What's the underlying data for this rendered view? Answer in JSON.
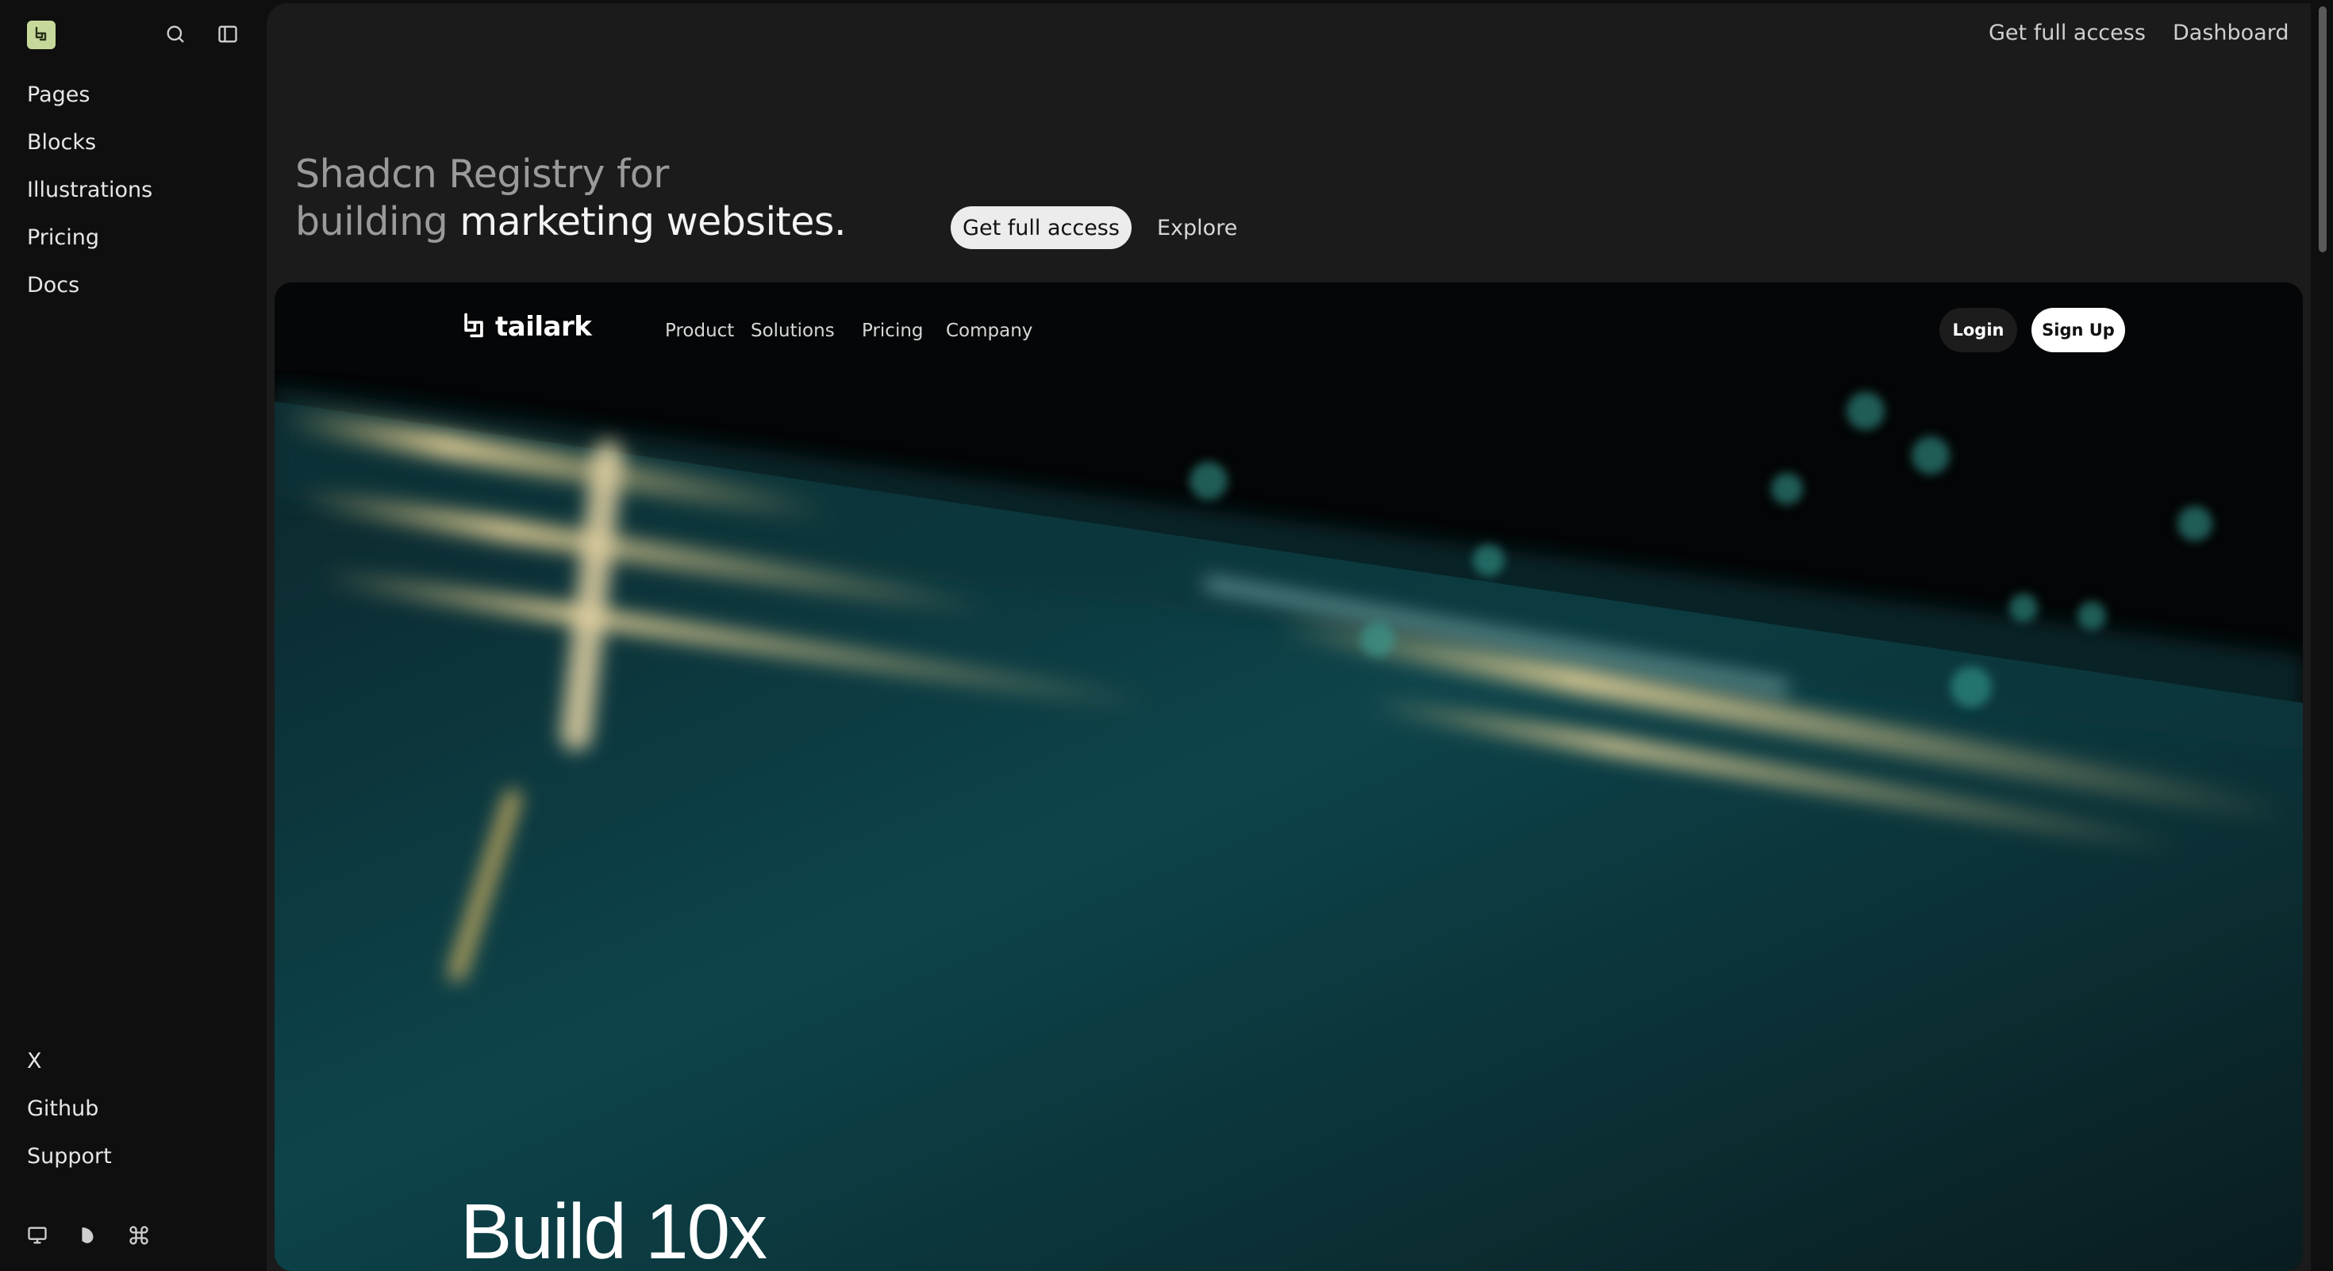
{
  "sidebar": {
    "items": [
      {
        "label": "Pages"
      },
      {
        "label": "Blocks"
      },
      {
        "label": "Illustrations"
      },
      {
        "label": "Pricing"
      },
      {
        "label": "Docs"
      }
    ],
    "footer_links": [
      {
        "label": "X"
      },
      {
        "label": "Github"
      },
      {
        "label": "Support"
      }
    ],
    "icons": [
      "logo-icon",
      "search-icon",
      "sidebar-toggle-icon",
      "monitor-icon",
      "theme-icon",
      "command-icon"
    ]
  },
  "topbar": {
    "get_full_access": "Get full access",
    "dashboard": "Dashboard"
  },
  "hero": {
    "line1": "Shadcn Registry for",
    "line2_muted": "building",
    "line2_strong": "marketing websites.",
    "primary_button": "Get full access",
    "secondary_button": "Explore"
  },
  "preview": {
    "brand": "tailark",
    "nav": [
      "Product",
      "Solutions",
      "Pricing",
      "Company"
    ],
    "login": "Login",
    "signup": "Sign Up",
    "heading": "Build 10x"
  },
  "colors": {
    "logo_badge": "#c7d99a",
    "main_bg": "#1b1b1b",
    "sidebar_bg": "#0f0f0f"
  }
}
